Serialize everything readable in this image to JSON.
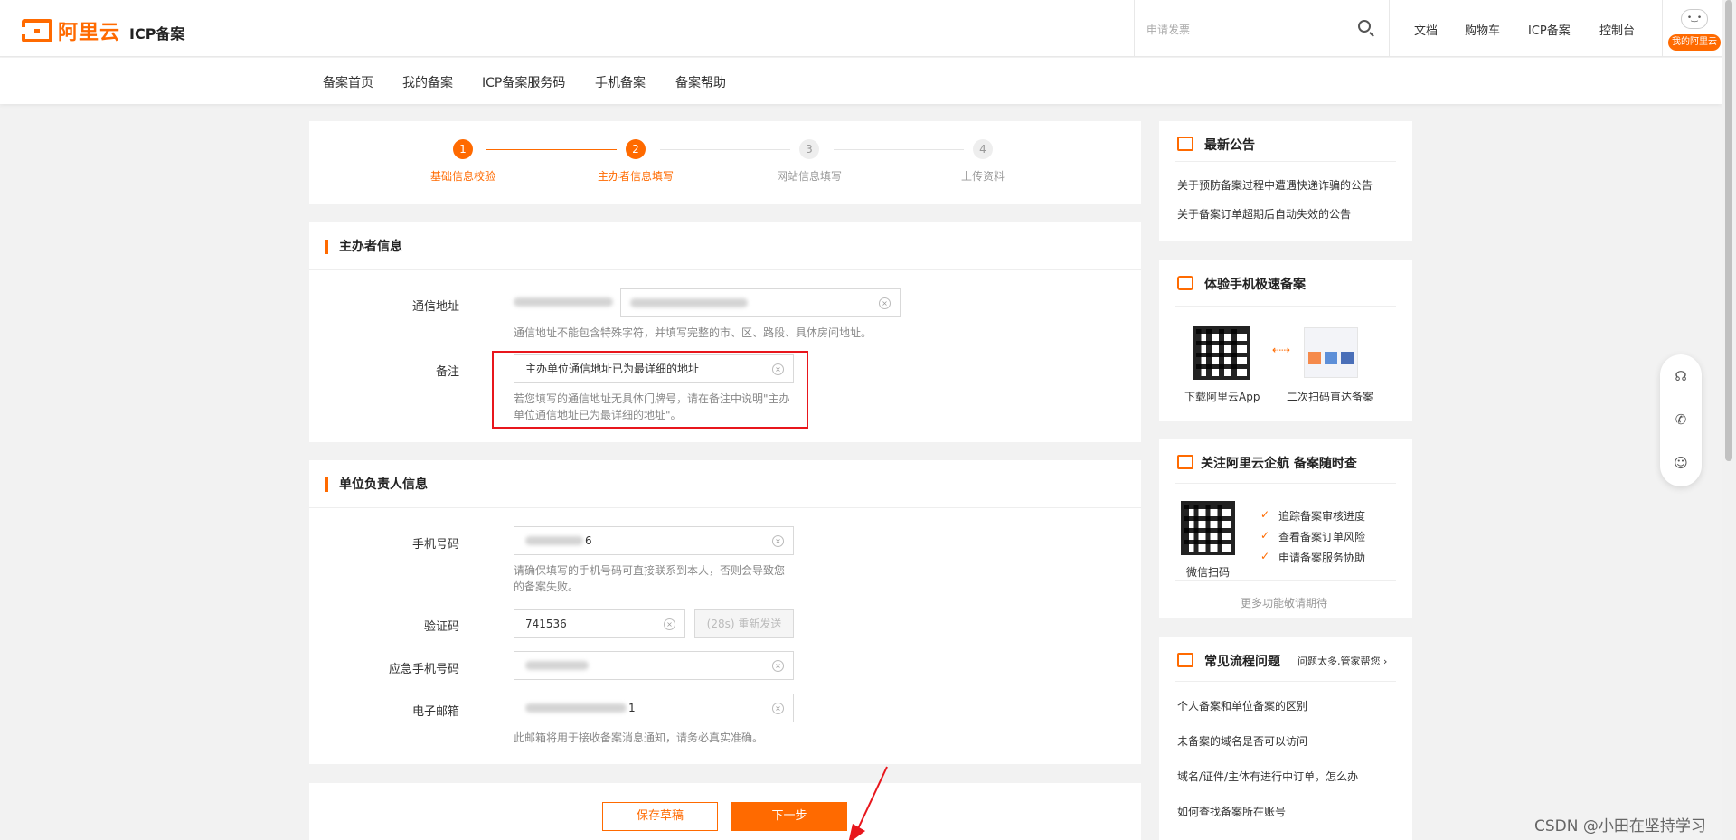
{
  "header": {
    "logo_text": "阿里云",
    "product_name": "ICP备案",
    "search_placeholder": "申请发票",
    "nav": [
      "文档",
      "购物车",
      "ICP备案",
      "控制台"
    ],
    "avatar_text": "• ͜ •",
    "avatar_badge": "我的阿里云"
  },
  "subnav": [
    "备案首页",
    "我的备案",
    "ICP备案服务码",
    "手机备案",
    "备案帮助"
  ],
  "steps": [
    {
      "num": "1",
      "label": "基础信息校验",
      "state": "done"
    },
    {
      "num": "2",
      "label": "主办者信息填写",
      "state": "done"
    },
    {
      "num": "3",
      "label": "网站信息填写",
      "state": "todo"
    },
    {
      "num": "4",
      "label": "上传资料",
      "state": "todo"
    }
  ],
  "sponsor_section": {
    "title": "主办者信息",
    "address_label": "通信地址",
    "address_hint": "通信地址不能包含特殊字符，并填写完整的市、区、路段、具体房间地址。",
    "remark_label": "备注",
    "remark_value": "主办单位通信地址已为最详细的地址",
    "remark_hint_1": "若您填写的通信地址无具体门牌号，请在备注中说明\"主办",
    "remark_hint_2": "单位通信地址已为最详细的地址\"。"
  },
  "owner_section": {
    "title": "单位负责人信息",
    "phone_label": "手机号码",
    "phone_value_tail": "6",
    "phone_hint_1": "请确保填写的手机号码可直接联系到本人，否则会导致您",
    "phone_hint_2": "的备案失败。",
    "code_label": "验证码",
    "code_value": "741536",
    "resend_label": "(28s) 重新发送",
    "emergency_label": "应急手机号码",
    "email_label": "电子邮箱",
    "email_value_tail": "1",
    "email_hint": "此邮箱将用于接收备案消息通知，请务必真实准确。"
  },
  "actions": {
    "save_draft": "保存草稿",
    "next": "下一步"
  },
  "sidebar": {
    "announcements": {
      "title": "最新公告",
      "items": [
        "关于预防备案过程中遭遇快递诈骗的公告",
        "关于备案订单超期后自动失效的公告"
      ]
    },
    "mobile": {
      "title": "体验手机极速备案",
      "download_label": "下载阿里云App",
      "scan_label": "二次扫码直达备案"
    },
    "wechat": {
      "title": "关注阿里云企航 备案随时查",
      "scan_label": "微信扫码",
      "features": [
        "追踪备案审核进度",
        "查看备案订单风险",
        "申请备案服务协助"
      ],
      "more": "更多功能敬请期待"
    },
    "faq": {
      "title": "常见流程问题",
      "link": "问题太多,管家帮您",
      "items": [
        "个人备案和单位备案的区别",
        "未备案的域名是否可以访问",
        "域名/证件/主体有进行中订单，怎么办",
        "如何查找备案所在账号"
      ]
    }
  },
  "watermark": "CSDN @小田在坚持学习",
  "colors": {
    "accent": "#ff6a00",
    "highlight": "#e8161c"
  }
}
